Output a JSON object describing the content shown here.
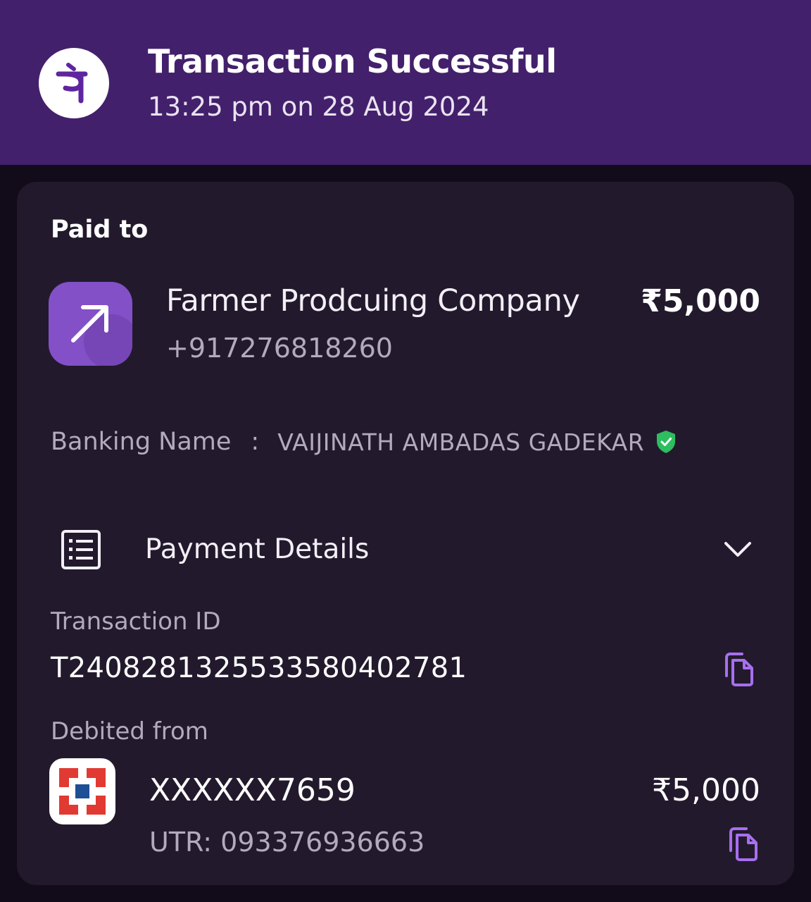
{
  "header": {
    "title": "Transaction Successful",
    "timestamp": "13:25 pm on 28 Aug 2024",
    "logo_icon": "phonepe-logo-icon",
    "background_color": "#43206b"
  },
  "paid_to": {
    "label": "Paid to",
    "payee_name": "Farmer Prodcuing Company",
    "phone": "+917276818260",
    "amount": "₹5,000",
    "icon": "arrow-up-right-icon",
    "icon_color": "#8350c8"
  },
  "banking_name": {
    "label": "Banking Name",
    "separator": ":",
    "value": "VAIJINATH AMBADAS GADEKAR",
    "verified_icon": "verified-shield-icon",
    "verified_color": "#2ebd5f"
  },
  "payment_details": {
    "title": "Payment Details",
    "icon": "receipt-list-icon",
    "toggle_icon": "chevron-down-icon",
    "transaction_id_label": "Transaction ID",
    "transaction_id": "T2408281325533580402781",
    "debited_from_label": "Debited from",
    "account_number": "XXXXXX7659",
    "debit_amount": "₹5,000",
    "utr": "UTR: 093376936663",
    "bank_logo": "bank-logo-icon",
    "copy_icon": "copy-icon",
    "accent_color": "#a76ff0"
  }
}
